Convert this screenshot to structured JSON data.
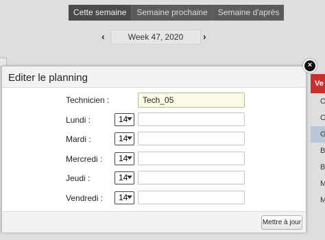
{
  "week_tabs": [
    "Cette semaine",
    "Semaine prochaine",
    "Semaine d'après"
  ],
  "week_nav": {
    "prev": "‹",
    "label": "Week 47, 2020",
    "next": "›"
  },
  "side_column": {
    "header": "Ve",
    "cells": [
      "C",
      "C",
      "Gl",
      "B",
      "B",
      "M",
      "M"
    ]
  },
  "modal": {
    "title": "Editer le planning",
    "close_symbol": "×",
    "technician": {
      "label": "Technicien :",
      "value": "Tech_05"
    },
    "days": [
      {
        "label": "Lundi :",
        "select": "14",
        "text": ""
      },
      {
        "label": "Mardi :",
        "select": "14",
        "text": ""
      },
      {
        "label": "Mercredi :",
        "select": "14",
        "text": ""
      },
      {
        "label": "Jeudi :",
        "select": "14",
        "text": ""
      },
      {
        "label": "Vendredi :",
        "select": "14",
        "text": ""
      }
    ],
    "update_button": "Mettre à jour"
  }
}
